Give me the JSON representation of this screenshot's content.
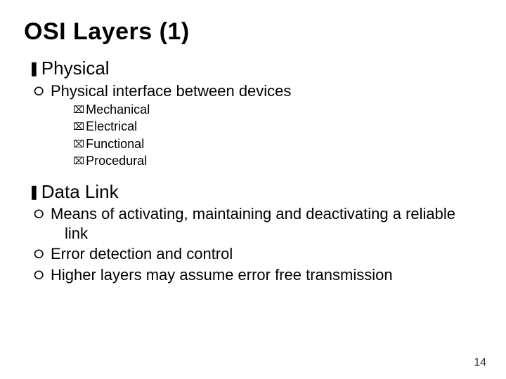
{
  "title": "OSI Layers (1)",
  "bullets": {
    "physical": {
      "label": "Physical",
      "sub1": "Physical interface between devices",
      "subsub": {
        "a": "Mechanical",
        "b": "Electrical",
        "c": "Functional",
        "d": "Procedural"
      }
    },
    "datalink": {
      "label": "Data Link",
      "sub1": "Means of activating, maintaining and deactivating a reliable link",
      "sub2": "Error detection and control",
      "sub3": "Higher layers may assume error free transmission"
    }
  },
  "glyphs": {
    "l1": "❚",
    "l2": "⭘",
    "l3": "⌧"
  },
  "page_number": "14"
}
